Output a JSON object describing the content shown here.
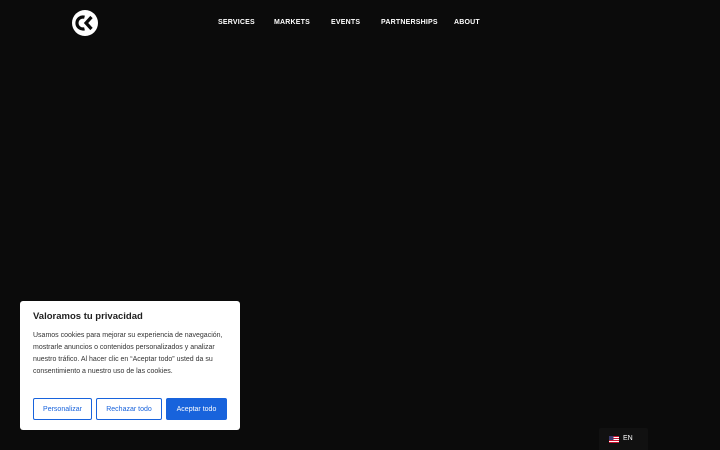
{
  "header": {
    "logo_icon": "ck-logo-icon",
    "nav": [
      {
        "label": "SERVICES"
      },
      {
        "label": "MARKETS"
      },
      {
        "label": "EVENTS"
      },
      {
        "label": "PARTNERSHIPS"
      },
      {
        "label": "ABOUT"
      }
    ]
  },
  "cookie_banner": {
    "title": "Valoramos tu privacidad",
    "body": "Usamos cookies para mejorar su experiencia de navegación, mostrarle anuncios o contenidos personalizados y analizar nuestro tráfico. Al hacer clic en “Aceptar todo” usted da su consentimiento a nuestro uso de las cookies.",
    "customize_label": "Personalizar",
    "reject_label": "Rechazar todo",
    "accept_label": "Aceptar todo",
    "accent_color": "#1863dc"
  },
  "language_switcher": {
    "flag_icon": "us-flag-icon",
    "label": "EN"
  },
  "colors": {
    "background": "#0b0b0b",
    "nav_text": "#ffffff"
  }
}
